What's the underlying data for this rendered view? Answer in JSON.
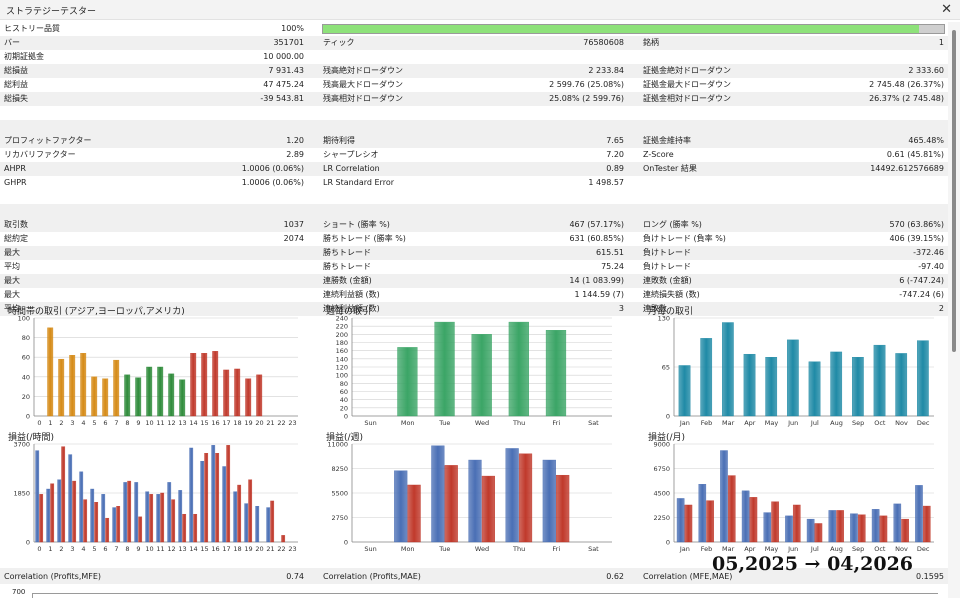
{
  "window": {
    "title": "ストラテジーテスター"
  },
  "stats": {
    "history_quality": {
      "label": "ヒストリー品質",
      "value": "100%",
      "fraction": 0.96
    },
    "row_bars": [
      {
        "label": "バー",
        "value": "351701"
      },
      {
        "label": "ティック",
        "value": "76580608"
      },
      {
        "label": "銘柄",
        "value": "1"
      }
    ],
    "initial_deposit": {
      "label": "初期証拠金",
      "value": "10 000.00"
    },
    "block1": [
      [
        {
          "label": "総損益",
          "value": "7 931.43"
        },
        {
          "label": "残高絶対ドローダウン",
          "value": "2 233.84"
        },
        {
          "label": "証拠金絶対ドローダウン",
          "value": "2 333.60"
        }
      ],
      [
        {
          "label": "総利益",
          "value": "47 475.24"
        },
        {
          "label": "残高最大ドローダウン",
          "value": "2 599.76 (25.08%)"
        },
        {
          "label": "証拠金最大ドローダウン",
          "value": "2 745.48 (26.37%)"
        }
      ],
      [
        {
          "label": "総損失",
          "value": "-39 543.81"
        },
        {
          "label": "残高相対ドローダウン",
          "value": "25.08% (2 599.76)"
        },
        {
          "label": "証拠金相対ドローダウン",
          "value": "26.37% (2 745.48)"
        }
      ]
    ],
    "block2": [
      [
        {
          "label": "プロフィットファクター",
          "value": "1.20"
        },
        {
          "label": "期待利得",
          "value": "7.65"
        },
        {
          "label": "証拠金維持率",
          "value": "465.48%"
        }
      ],
      [
        {
          "label": "リカバリファクター",
          "value": "2.89"
        },
        {
          "label": "シャープレシオ",
          "value": "7.20"
        },
        {
          "label": "Z-Score",
          "value": "0.61 (45.81%)"
        }
      ],
      [
        {
          "label": "AHPR",
          "value": "1.0006 (0.06%)"
        },
        {
          "label": "LR Correlation",
          "value": "0.89"
        },
        {
          "label": "OnTester 結果",
          "value": "14492.6125766​89"
        }
      ],
      [
        {
          "label": "GHPR",
          "value": "1.0006 (0.06%)"
        },
        {
          "label": "LR Standard Error",
          "value": "1 498.57"
        },
        {
          "label": "",
          "value": ""
        }
      ]
    ],
    "block3": [
      [
        {
          "label": "取引数",
          "value": "1037"
        },
        {
          "label": "ショート (勝率 %)",
          "value": "467 (57.17%)"
        },
        {
          "label": "ロング (勝率 %)",
          "value": "570 (63.86%)"
        }
      ],
      [
        {
          "label": "総約定",
          "value": "2074"
        },
        {
          "label": "勝ちトレード (勝率 %)",
          "value": "631 (60.85%)"
        },
        {
          "label": "負けトレード (負率 %)",
          "value": "406 (39.15%)"
        }
      ],
      [
        {
          "label": "最大",
          "value": ""
        },
        {
          "label": "勝ちトレード",
          "value": "615.51"
        },
        {
          "label": "負けトレード",
          "value": "-372.46"
        }
      ],
      [
        {
          "label": "平均",
          "value": ""
        },
        {
          "label": "勝ちトレード",
          "value": "75.24"
        },
        {
          "label": "負けトレード",
          "value": "-97.40"
        }
      ],
      [
        {
          "label": "最大",
          "value": ""
        },
        {
          "label": "連勝数 (金額)",
          "value": "14 (1 083.99)"
        },
        {
          "label": "連敗数 (金額)",
          "value": "6 (-747.24)"
        }
      ],
      [
        {
          "label": "最大",
          "value": ""
        },
        {
          "label": "連続利益額 (数)",
          "value": "1 144.59 (7)"
        },
        {
          "label": "連続損失額 (数)",
          "value": "-747.24 (6)"
        }
      ],
      [
        {
          "label": "平均",
          "value": ""
        },
        {
          "label": "連続利益額 (数)",
          "value": "3"
        },
        {
          "label": "連敗数",
          "value": "2"
        }
      ]
    ],
    "correlations": [
      {
        "label": "Correlation (Profits,MFE)",
        "value": "0.74"
      },
      {
        "label": "Correlation (Profits,MAE)",
        "value": "0.62"
      },
      {
        "label": "Correlation (MFE,MAE)",
        "value": "0.1595"
      }
    ]
  },
  "overlay_stamp": "05,2025 → 04,2026",
  "bottom_axis_tick": "700",
  "colors": {
    "orange": "#d58a16",
    "red": "#c0392b",
    "green": "#2e8b3a",
    "blue": "#4a6fb5",
    "lightgreen": "#3ba566",
    "teal": "#1f8aa6"
  },
  "chart_data": [
    {
      "type": "bar",
      "title": "時間帯の取引 (アジア,ヨーロッパ,アメリカ)",
      "categories": [
        "0",
        "1",
        "2",
        "3",
        "4",
        "5",
        "6",
        "7",
        "8",
        "9",
        "10",
        "11",
        "12",
        "13",
        "14",
        "15",
        "16",
        "17",
        "18",
        "19",
        "20",
        "21",
        "22",
        "23"
      ],
      "values": [
        0,
        90,
        58,
        62,
        64,
        40,
        38,
        57,
        42,
        39,
        50,
        50,
        43,
        37,
        64,
        64,
        66,
        47,
        48,
        38,
        42,
        0,
        0,
        0
      ],
      "ylim": [
        0,
        100
      ],
      "yticks": [
        0,
        20,
        40,
        60,
        80,
        100
      ],
      "segment_colors": {
        "0-7": "orange",
        "8-13": "green",
        "14-23": "red"
      }
    },
    {
      "type": "bar",
      "title": "週毎の取引",
      "categories": [
        "Sun",
        "Mon",
        "Tue",
        "Wed",
        "Thu",
        "Fri",
        "Sat"
      ],
      "values": [
        0,
        168,
        230,
        200,
        230,
        210,
        0
      ],
      "ylim": [
        0,
        240
      ],
      "yticks": [
        0,
        20,
        40,
        60,
        80,
        100,
        120,
        140,
        160,
        180,
        200,
        220,
        240
      ],
      "color": "lightgreen"
    },
    {
      "type": "bar",
      "title": "月毎の取引",
      "categories": [
        "Jan",
        "Feb",
        "Mar",
        "Apr",
        "May",
        "Jun",
        "Jul",
        "Aug",
        "Sep",
        "Oct",
        "Nov",
        "Dec"
      ],
      "values": [
        67,
        103,
        124,
        82,
        78,
        101,
        72,
        85,
        78,
        94,
        83,
        100
      ],
      "ylim": [
        0,
        130
      ],
      "yticks": [
        0,
        65,
        130
      ],
      "color": "teal"
    },
    {
      "type": "bar",
      "title": "損益(/時間)",
      "categories": [
        "0",
        "1",
        "2",
        "3",
        "4",
        "5",
        "6",
        "7",
        "8",
        "9",
        "10",
        "11",
        "12",
        "13",
        "14",
        "15",
        "16",
        "17",
        "18",
        "19",
        "20",
        "21",
        "22",
        "23"
      ],
      "series": [
        {
          "values": [
            3450,
            2000,
            2350,
            3300,
            2650,
            2000,
            1800,
            1300,
            2250,
            2250,
            1900,
            1800,
            2250,
            1950,
            3550,
            3050,
            3650,
            2850,
            1900,
            1450,
            1350,
            1300,
            0,
            0
          ],
          "color": "blue"
        },
        {
          "values": [
            1800,
            2200,
            3600,
            2300,
            1600,
            1500,
            900,
            1350,
            2300,
            950,
            1800,
            1850,
            1600,
            1050,
            1050,
            3350,
            3350,
            3650,
            2150,
            2350,
            0,
            1550,
            250,
            0
          ],
          "color": "red"
        }
      ],
      "ylim": [
        0,
        3700
      ],
      "yticks": [
        0,
        1850,
        3700
      ]
    },
    {
      "type": "bar",
      "title": "損益(/週)",
      "categories": [
        "Sun",
        "Mon",
        "Tue",
        "Wed",
        "Thu",
        "Fri",
        "Sat"
      ],
      "series": [
        {
          "values": [
            0,
            8000,
            10800,
            9200,
            10500,
            9200,
            0
          ],
          "color": "blue"
        },
        {
          "values": [
            0,
            6400,
            8600,
            7400,
            9900,
            7500,
            0
          ],
          "color": "red"
        }
      ],
      "ylim": [
        0,
        11000
      ],
      "yticks": [
        0,
        2750,
        5500,
        8250,
        11000
      ]
    },
    {
      "type": "bar",
      "title": "損益(/月)",
      "categories": [
        "Jan",
        "Feb",
        "Mar",
        "Apr",
        "May",
        "Jun",
        "Jul",
        "Aug",
        "Sep",
        "Oct",
        "Nov",
        "Dec"
      ],
      "series": [
        {
          "values": [
            4000,
            5300,
            8400,
            4700,
            2700,
            2400,
            2100,
            2900,
            2600,
            3000,
            3500,
            5200
          ],
          "color": "blue"
        },
        {
          "values": [
            3400,
            3800,
            6100,
            4100,
            3700,
            3400,
            1700,
            2900,
            2500,
            2400,
            2100,
            3300
          ],
          "color": "red"
        }
      ],
      "ylim": [
        0,
        9000
      ],
      "yticks": [
        0,
        2250,
        4500,
        6750,
        9000
      ]
    }
  ]
}
